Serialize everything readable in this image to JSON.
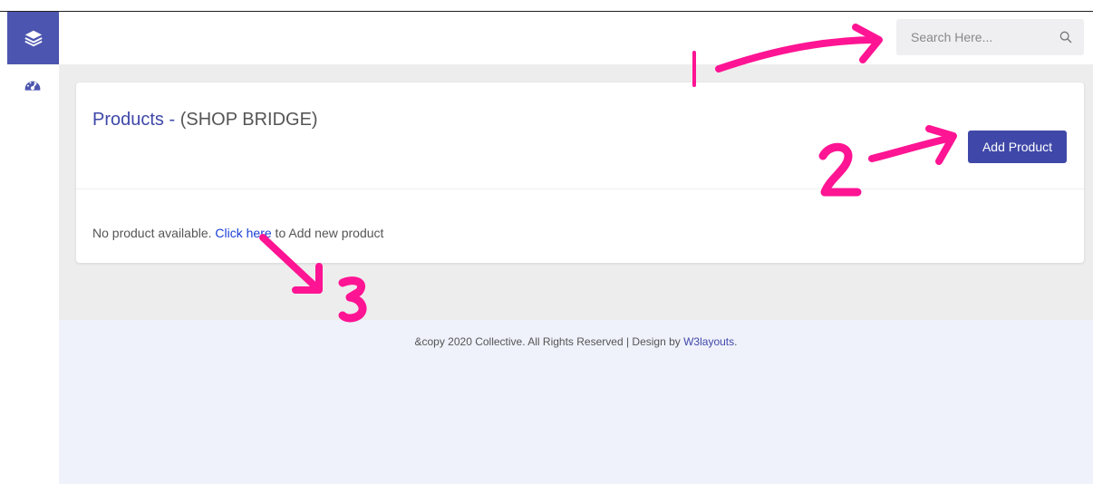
{
  "search": {
    "placeholder": "Search Here..."
  },
  "card": {
    "title_main": "Products - ",
    "title_sub": "(SHOP BRIDGE)",
    "add_button_label": "Add Product",
    "empty_prefix": "No product available. ",
    "empty_link": "Click here",
    "empty_suffix": " to Add new product"
  },
  "footer": {
    "text": "&copy 2020 Collective. All Rights Reserved | Design by ",
    "link": "W3layouts",
    "end": "."
  },
  "annotations": {
    "label_1": "1",
    "label_2": "2",
    "label_3": "3"
  },
  "colors": {
    "accent": "#3f48a8",
    "annotation": "#ff1493"
  }
}
